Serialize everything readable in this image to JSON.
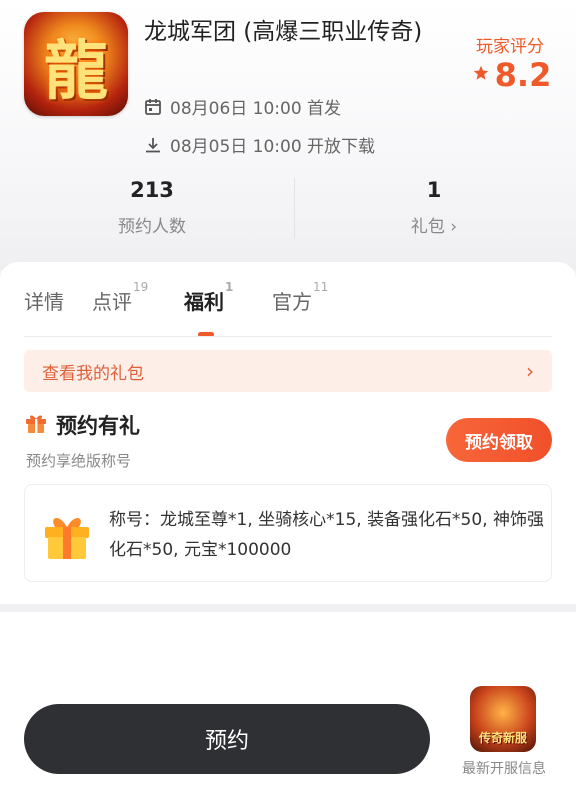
{
  "app": {
    "icon_glyph": "龍",
    "title": "龙城军团 (高爆三职业传奇)",
    "release_date": "08月06日 10:00 首发",
    "download_date": "08月05日 10:00 开放下载",
    "rating_label": "玩家评分",
    "rating_value": "8.2"
  },
  "stats": {
    "reservations": {
      "value": "213",
      "label": "预约人数"
    },
    "gifts": {
      "value": "1",
      "label": "礼包 ›"
    }
  },
  "tabs": [
    {
      "label": "详情",
      "count": ""
    },
    {
      "label": "点评",
      "count": "19"
    },
    {
      "label": "福利",
      "count": "1"
    },
    {
      "label": "官方",
      "count": "11"
    }
  ],
  "benefits": {
    "my_gift_link": "查看我的礼包",
    "section_title": "预约有礼",
    "section_subtitle": "预约享绝版称号",
    "reserve_claim_button": "预约领取",
    "reward_text": "称号：龙城至尊*1, 坐骑核心*15, 装备强化石*50, 神饰强化石*50, 元宝*100000"
  },
  "bottom": {
    "reserve_button": "预约",
    "server_thumb_text": "传奇新服",
    "server_label": "最新开服信息"
  },
  "colors": {
    "accent": "#f05a2a",
    "dark_button": "#2e3033"
  }
}
